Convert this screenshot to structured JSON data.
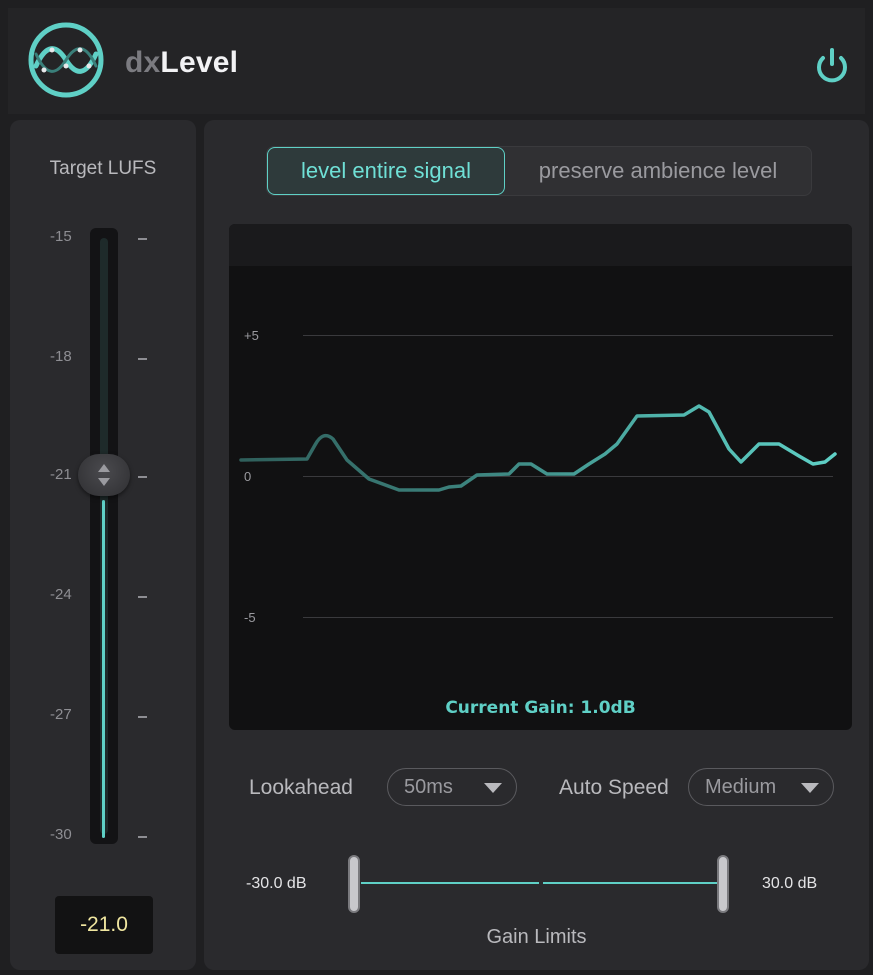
{
  "app": {
    "brand_prefix": "dx",
    "brand_name": "Level"
  },
  "target": {
    "title": "Target LUFS",
    "ticks": [
      "-15",
      "-18",
      "-21",
      "-24",
      "-27",
      "-30"
    ],
    "value": "-21.0",
    "level_fraction": 0.5
  },
  "mode": {
    "options": [
      "level entire signal",
      "preserve ambience level"
    ],
    "selected": "level entire signal"
  },
  "graph": {
    "gridlines": [
      "+5",
      "0",
      "-5"
    ],
    "current_gain": "Current Gain: 1.0dB"
  },
  "lookahead": {
    "label": "Lookahead",
    "value": "50ms"
  },
  "auto_speed": {
    "label": "Auto Speed",
    "value": "Medium"
  },
  "gain_limits": {
    "title": "Gain Limits",
    "min": "-30.0 dB",
    "max": "30.0 dB"
  },
  "colors": {
    "accent": "#5fd0c6",
    "value_text": "#f0e6a0",
    "background": "#1f1f21"
  },
  "icons": {
    "logo": "waveform-logo-icon",
    "power": "power-icon",
    "fader_knob": "up-down-arrows-icon",
    "caret": "chevron-down-icon"
  }
}
